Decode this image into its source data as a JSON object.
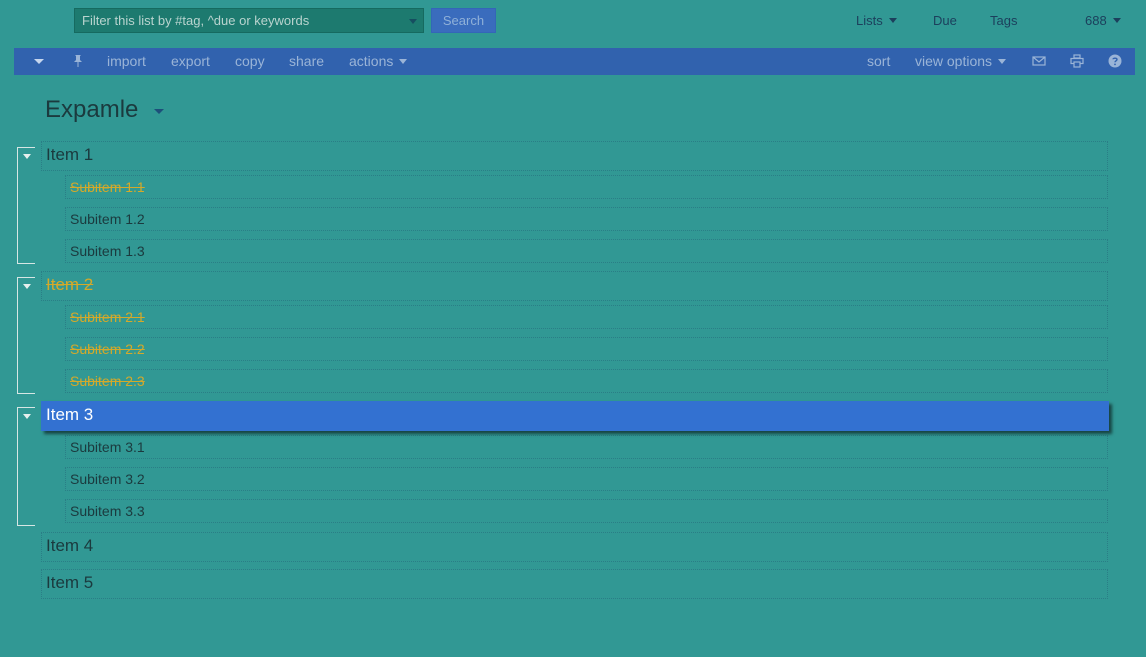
{
  "topbar": {
    "filter_placeholder": "Filter this list by #tag, ^due or keywords",
    "search_label": "Search",
    "lists_label": "Lists",
    "due_label": "Due",
    "tags_label": "Tags",
    "count_label": "688"
  },
  "toolbar": {
    "import_label": "import",
    "export_label": "export",
    "copy_label": "copy",
    "share_label": "share",
    "actions_label": "actions",
    "sort_label": "sort",
    "view_options_label": "view options",
    "icons": [
      "chevron-down-icon",
      "pin-icon",
      "mail-icon",
      "print-icon",
      "help-icon"
    ]
  },
  "list": {
    "title": "Expamle",
    "items": [
      {
        "label": "Item 1",
        "done": false,
        "subitems": [
          {
            "label": "Subitem 1.1",
            "done": true
          },
          {
            "label": "Subitem 1.2",
            "done": false
          },
          {
            "label": "Subitem 1.3",
            "done": false
          }
        ]
      },
      {
        "label": "Item 2",
        "done": true,
        "subitems": [
          {
            "label": "Subitem 2.1",
            "done": true
          },
          {
            "label": "Subitem 2.2",
            "done": true
          },
          {
            "label": "Subitem 2.3",
            "done": true
          }
        ]
      },
      {
        "label": "Item 3",
        "done": false,
        "selected": true,
        "subitems": [
          {
            "label": "Subitem 3.1",
            "done": false
          },
          {
            "label": "Subitem 3.2",
            "done": false
          },
          {
            "label": "Subitem 3.3",
            "done": false
          }
        ]
      },
      {
        "label": "Item 4",
        "done": false,
        "subitems": []
      },
      {
        "label": "Item 5",
        "done": false,
        "subitems": []
      }
    ]
  },
  "colors": {
    "background": "#319894",
    "toolbar": "#3162ae",
    "selected": "#3371d1",
    "completed": "#d4a92a"
  }
}
